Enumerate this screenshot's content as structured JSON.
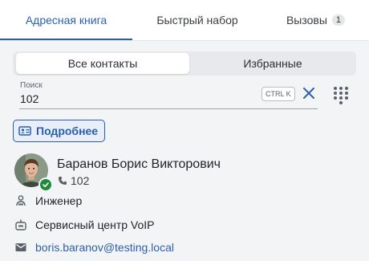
{
  "tabs": [
    {
      "label": "Адресная книга"
    },
    {
      "label": "Быстрый набор"
    },
    {
      "label": "Вызовы",
      "count": "1"
    }
  ],
  "segments": {
    "all": "Все контакты",
    "favorites": "Избранные"
  },
  "search": {
    "label": "Поиск",
    "value": "102",
    "shortcut": "CTRL K"
  },
  "details_button": {
    "label": "Подробнее"
  },
  "contact": {
    "name": "Баранов Борис Викторович",
    "extension": "102",
    "position": "Инженер",
    "department": "Сервисный центр VoIP",
    "email": "boris.baranov@testing.local"
  },
  "colors": {
    "accent": "#2b5fad",
    "online": "#1f8a3b",
    "background": "#f3f4f6"
  },
  "icons": [
    "phone-icon",
    "close-icon",
    "dialpad-icon",
    "contact-card-icon",
    "person-icon",
    "department-icon",
    "email-icon",
    "online-status-icon"
  ]
}
